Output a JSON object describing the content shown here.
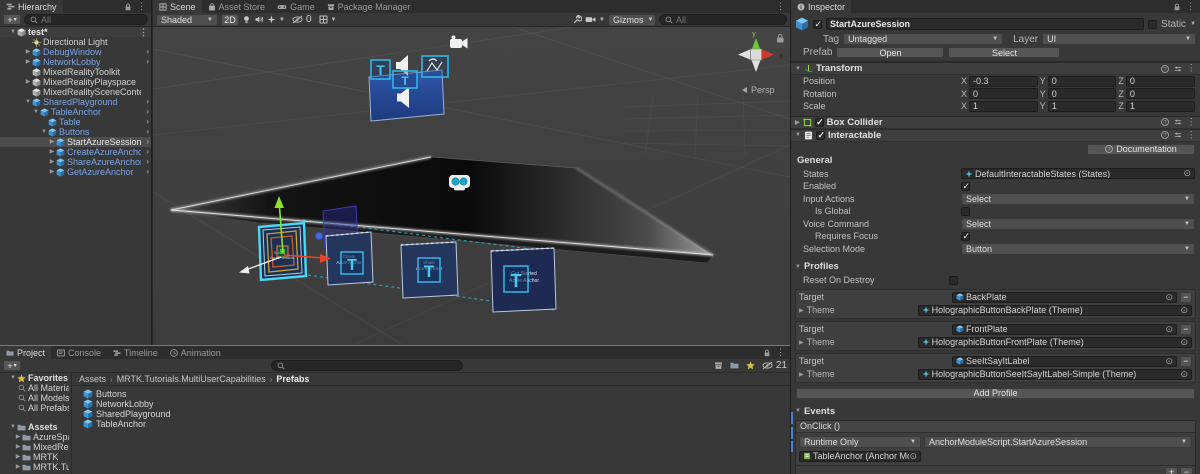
{
  "hierarchy": {
    "title": "Hierarchy",
    "search_placeholder": "All",
    "scene_row": "test*",
    "items": [
      {
        "label": "Directional Light"
      },
      {
        "label": "DebugWindow"
      },
      {
        "label": "NetworkLobby"
      },
      {
        "label": "MixedRealityToolkit"
      },
      {
        "label": "MixedRealityPlayspace"
      },
      {
        "label": "MixedRealitySceneContent"
      },
      {
        "label": "SharedPlayground"
      },
      {
        "label": "TableAnchor"
      },
      {
        "label": "Table"
      },
      {
        "label": "Buttons"
      },
      {
        "label": "StartAzureSession"
      },
      {
        "label": "CreateAzureAnchor"
      },
      {
        "label": "ShareAzureAnchor"
      },
      {
        "label": "GetAzureAnchor"
      }
    ]
  },
  "scene": {
    "tabs": {
      "scene": "Scene",
      "asset_store": "Asset Store",
      "game": "Game",
      "package_manager": "Package Manager"
    },
    "shading_mode": "Shaded",
    "mode_2d": "2D",
    "hidden_count": "0",
    "gizmos_label": "Gizmos",
    "search_placeholder": "All",
    "persp_label": "Persp",
    "axis_x": "x",
    "axis_y": "y",
    "buttons": {
      "b1_line1": "Start",
      "b1_line2": "Azure Session",
      "b2_line1": "Create",
      "b2_line2": "Azure Anchor",
      "b3_line1": "Share",
      "b3_line2": "Azure Anchor",
      "b4_line1": "Get Started",
      "b4_line2": "Azure Anchor"
    }
  },
  "inspector": {
    "tab": "Inspector",
    "name": "StartAzureSession",
    "static_label": "Static",
    "tag_label": "Tag",
    "tag_value": "Untagged",
    "layer_label": "Layer",
    "layer_value": "UI",
    "prefab_label": "Prefab",
    "open_label": "Open",
    "select_label": "Select",
    "transform": {
      "title": "Transform",
      "position_label": "Position",
      "rotation_label": "Rotation",
      "scale_label": "Scale",
      "x": "X",
      "y": "Y",
      "z": "Z",
      "position": {
        "x": "-0.3",
        "y": "0",
        "z": "0"
      },
      "rotation": {
        "x": "0",
        "y": "0",
        "z": "0"
      },
      "scale": {
        "x": "1",
        "y": "1",
        "z": "1"
      }
    },
    "box_collider_title": "Box Collider",
    "interactable": {
      "title": "Interactable",
      "documentation_label": "Documentation",
      "general_title": "General",
      "states_label": "States",
      "states_value": "DefaultInteractableStates (States)",
      "enabled_label": "Enabled",
      "input_actions_label": "Input Actions",
      "input_actions_value": "Select",
      "is_global_label": "Is Global",
      "voice_command_label": "Voice Command",
      "voice_command_value": "Select",
      "requires_focus_label": "Requires Focus",
      "selection_mode_label": "Selection Mode",
      "selection_mode_value": "Button",
      "profiles_title": "Profiles",
      "reset_on_destroy_label": "Reset On Destroy",
      "target_label": "Target",
      "theme_label": "Theme",
      "profiles": [
        {
          "target": "BackPlate",
          "theme": "HolographicButtonBackPlate (Theme)"
        },
        {
          "target": "FrontPlate",
          "theme": "HolographicButtonFrontPlate (Theme)"
        },
        {
          "target": "SeeItSayItLabel",
          "theme": "HolographicButtonSeeItSayItLabel-Simple (Theme)"
        }
      ],
      "add_profile_label": "Add Profile",
      "events_title": "Events",
      "onclick_label": "OnClick ()",
      "runtime_mode": "Runtime Only",
      "handler": "AnchorModuleScript.StartAzureSession",
      "target_object": "TableAnchor (Anchor Mo"
    }
  },
  "project": {
    "tabs": {
      "project": "Project",
      "console": "Console",
      "timeline": "Timeline",
      "animation": "Animation"
    },
    "favorites_title": "Favorites",
    "favorites": [
      {
        "label": "All Materials"
      },
      {
        "label": "All Models"
      },
      {
        "label": "All Prefabs"
      }
    ],
    "assets_title": "Assets",
    "folders": [
      {
        "label": "AzureSpatia"
      },
      {
        "label": "MixedRealit"
      },
      {
        "label": "MRTK"
      },
      {
        "label": "MRTK.Tutor"
      }
    ],
    "breadcrumb": {
      "root": "Assets",
      "mid": "MRTK.Tutorials.MultiUserCapabilities",
      "leaf": "Prefabs"
    },
    "items": [
      {
        "label": "Buttons"
      },
      {
        "label": "NetworkLobby"
      },
      {
        "label": "SharedPlayground"
      },
      {
        "label": "TableAnchor"
      }
    ],
    "hidden_count": "21",
    "search_placeholder": ""
  }
}
